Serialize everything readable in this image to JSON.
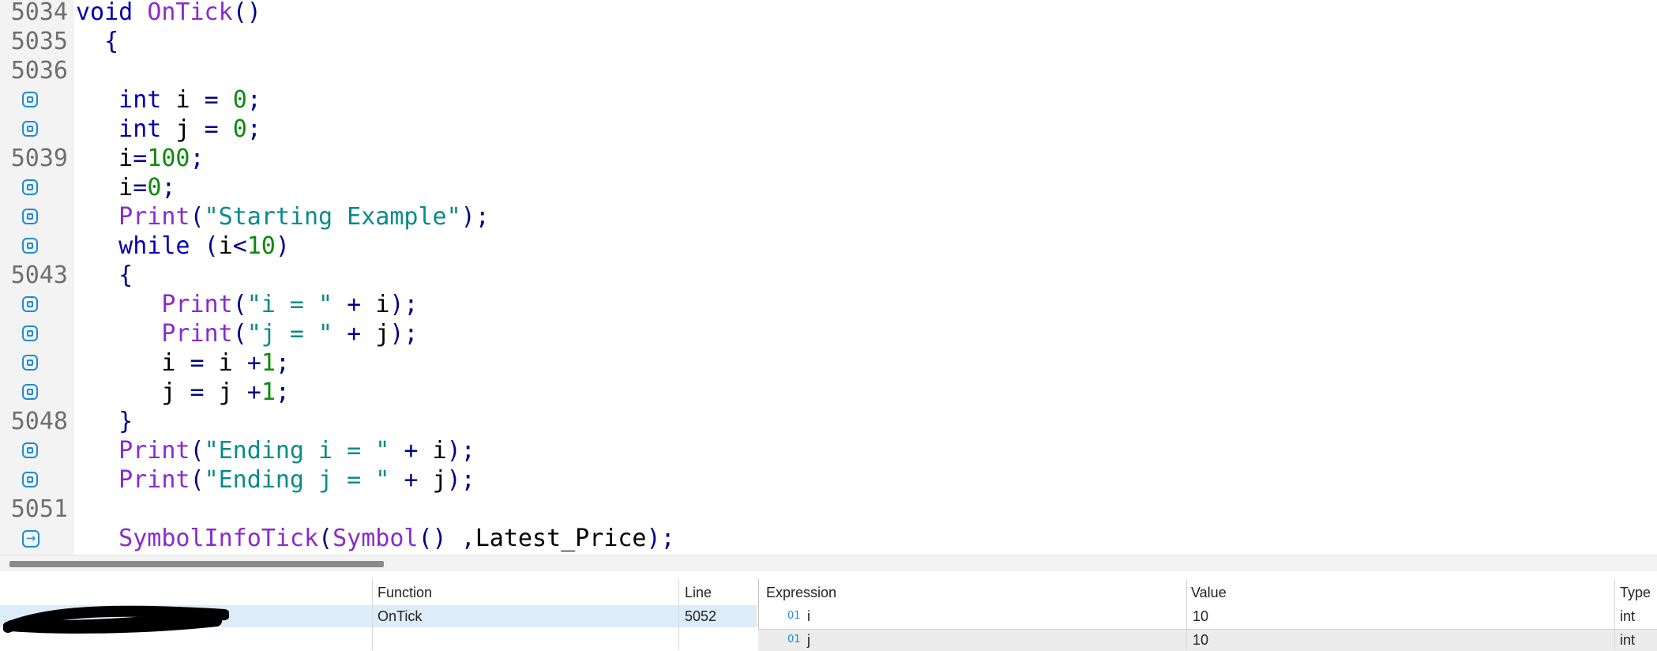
{
  "editor": {
    "lines": [
      {
        "num": "5034",
        "marker": "none",
        "tokens": [
          {
            "c": "kw",
            "t": "void "
          },
          {
            "c": "fn",
            "t": "OnTick"
          },
          {
            "c": "pun",
            "t": "()"
          }
        ]
      },
      {
        "num": "5035",
        "marker": "none",
        "tokens": [
          {
            "c": "pun",
            "t": "  {"
          }
        ]
      },
      {
        "num": "5036",
        "marker": "none",
        "tokens": []
      },
      {
        "num": "",
        "marker": "breakpoint",
        "tokens": [
          {
            "c": "kw",
            "t": "   int "
          },
          {
            "c": "id",
            "t": "i "
          },
          {
            "c": "pun",
            "t": "= "
          },
          {
            "c": "num",
            "t": "0"
          },
          {
            "c": "pun",
            "t": ";"
          }
        ]
      },
      {
        "num": "",
        "marker": "breakpoint",
        "tokens": [
          {
            "c": "kw",
            "t": "   int "
          },
          {
            "c": "id",
            "t": "j "
          },
          {
            "c": "pun",
            "t": "= "
          },
          {
            "c": "num",
            "t": "0"
          },
          {
            "c": "pun",
            "t": ";"
          }
        ]
      },
      {
        "num": "5039",
        "marker": "none",
        "tokens": [
          {
            "c": "id",
            "t": "   i"
          },
          {
            "c": "pun",
            "t": "="
          },
          {
            "c": "num",
            "t": "100"
          },
          {
            "c": "pun",
            "t": ";"
          }
        ]
      },
      {
        "num": "",
        "marker": "breakpoint",
        "tokens": [
          {
            "c": "id",
            "t": "   i"
          },
          {
            "c": "pun",
            "t": "="
          },
          {
            "c": "num",
            "t": "0"
          },
          {
            "c": "pun",
            "t": ";"
          }
        ]
      },
      {
        "num": "",
        "marker": "breakpoint",
        "tokens": [
          {
            "c": "fn",
            "t": "   Print"
          },
          {
            "c": "pun",
            "t": "("
          },
          {
            "c": "str",
            "t": "\"Starting Example\""
          },
          {
            "c": "pun",
            "t": ");"
          }
        ]
      },
      {
        "num": "",
        "marker": "breakpoint",
        "tokens": [
          {
            "c": "kw",
            "t": "   while "
          },
          {
            "c": "pun",
            "t": "("
          },
          {
            "c": "id",
            "t": "i"
          },
          {
            "c": "pun",
            "t": "<"
          },
          {
            "c": "num",
            "t": "10"
          },
          {
            "c": "pun",
            "t": ")"
          }
        ]
      },
      {
        "num": "5043",
        "marker": "none",
        "tokens": [
          {
            "c": "pun",
            "t": "   {"
          }
        ]
      },
      {
        "num": "",
        "marker": "breakpoint",
        "tokens": [
          {
            "c": "fn",
            "t": "      Print"
          },
          {
            "c": "pun",
            "t": "("
          },
          {
            "c": "str",
            "t": "\"i = \""
          },
          {
            "c": "pun",
            "t": " + "
          },
          {
            "c": "id",
            "t": "i"
          },
          {
            "c": "pun",
            "t": ");"
          }
        ]
      },
      {
        "num": "",
        "marker": "breakpoint",
        "tokens": [
          {
            "c": "fn",
            "t": "      Print"
          },
          {
            "c": "pun",
            "t": "("
          },
          {
            "c": "str",
            "t": "\"j = \""
          },
          {
            "c": "pun",
            "t": " + "
          },
          {
            "c": "id",
            "t": "j"
          },
          {
            "c": "pun",
            "t": ");"
          }
        ]
      },
      {
        "num": "",
        "marker": "breakpoint",
        "tokens": [
          {
            "c": "id",
            "t": "      i "
          },
          {
            "c": "pun",
            "t": "= "
          },
          {
            "c": "id",
            "t": "i "
          },
          {
            "c": "pun",
            "t": "+"
          },
          {
            "c": "num",
            "t": "1"
          },
          {
            "c": "pun",
            "t": ";"
          }
        ]
      },
      {
        "num": "",
        "marker": "breakpoint",
        "tokens": [
          {
            "c": "id",
            "t": "      j "
          },
          {
            "c": "pun",
            "t": "= "
          },
          {
            "c": "id",
            "t": "j "
          },
          {
            "c": "pun",
            "t": "+"
          },
          {
            "c": "num",
            "t": "1"
          },
          {
            "c": "pun",
            "t": ";"
          }
        ]
      },
      {
        "num": "5048",
        "marker": "none",
        "tokens": [
          {
            "c": "pun",
            "t": "   }"
          }
        ]
      },
      {
        "num": "",
        "marker": "breakpoint",
        "tokens": [
          {
            "c": "fn",
            "t": "   Print"
          },
          {
            "c": "pun",
            "t": "("
          },
          {
            "c": "str",
            "t": "\"Ending i = \""
          },
          {
            "c": "pun",
            "t": " + "
          },
          {
            "c": "id",
            "t": "i"
          },
          {
            "c": "pun",
            "t": ");"
          }
        ]
      },
      {
        "num": "",
        "marker": "breakpoint",
        "tokens": [
          {
            "c": "fn",
            "t": "   Print"
          },
          {
            "c": "pun",
            "t": "("
          },
          {
            "c": "str",
            "t": "\"Ending j = \""
          },
          {
            "c": "pun",
            "t": " + "
          },
          {
            "c": "id",
            "t": "j"
          },
          {
            "c": "pun",
            "t": ");"
          }
        ]
      },
      {
        "num": "5051",
        "marker": "none",
        "tokens": []
      },
      {
        "num": "",
        "marker": "current",
        "tokens": [
          {
            "c": "fn",
            "t": "   SymbolInfoTick"
          },
          {
            "c": "pun",
            "t": "("
          },
          {
            "c": "fn",
            "t": "Symbol"
          },
          {
            "c": "pun",
            "t": "() ,"
          },
          {
            "c": "id",
            "t": "Latest_Price"
          },
          {
            "c": "pun",
            "t": ");"
          }
        ]
      }
    ],
    "marker_icons": {
      "breakpoint": "breakpoint-icon",
      "current": "current-line-arrow-icon"
    },
    "arrow_glyph": "→",
    "colors": {
      "keyword": "#0000b0",
      "function": "#8a2bcc",
      "number": "#0b8a0b",
      "string": "#0b8a8a",
      "marker": "#1c8bd6",
      "gutter": "#f3f3f3"
    }
  },
  "callstack": {
    "headers": {
      "function": "Function",
      "line": "Line"
    },
    "rows": [
      {
        "function": "OnTick",
        "line": "5052"
      }
    ]
  },
  "watch": {
    "headers": {
      "expression": "Expression",
      "value": "Value",
      "type": "Type"
    },
    "rows": [
      {
        "icon": "01",
        "expression": "i",
        "value": "10",
        "type": "int"
      },
      {
        "icon": "01",
        "expression": "j",
        "value": "10",
        "type": "int"
      }
    ]
  }
}
